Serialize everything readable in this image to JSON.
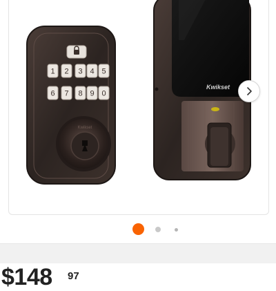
{
  "gallery": {
    "image": {
      "subject": "keypad-deadbolt-lock",
      "brand_text": "Kwikset",
      "keypad_keys": [
        "1",
        "2",
        "3",
        "4",
        "5",
        "6",
        "7",
        "8",
        "9",
        "0"
      ],
      "finish_color": "#3a2f2b"
    },
    "next_icon": "chevron-right-icon",
    "dots": {
      "count": 3,
      "active_index": 0,
      "active_color": "#f96302"
    }
  },
  "price": {
    "dollars": "$148",
    "cents": "97"
  }
}
